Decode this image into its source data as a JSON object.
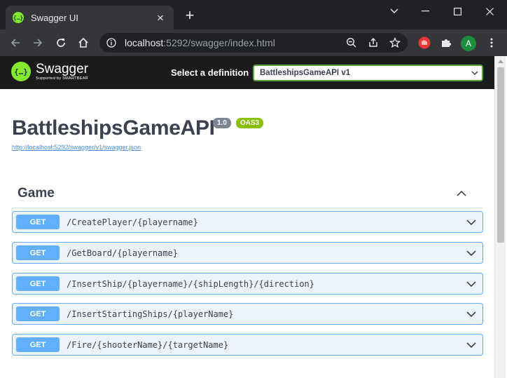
{
  "browser": {
    "tab_title": "Swagger UI",
    "favicon_glyph": "{…}",
    "new_tab_symbol": "+",
    "close_symbol": "×",
    "url_host": "localhost",
    "url_rest": ":5292/swagger/index.html",
    "profile_initial": "A",
    "colors": {
      "frame": "#202124",
      "toolbar": "#35363a",
      "avatar": "#1e8e3e",
      "extension_red": "#e53935"
    }
  },
  "swagger": {
    "topbar": {
      "logo_glyph": "{…}",
      "logo_name": "Swagger",
      "logo_sub": "Supported by SMARTBEAR",
      "definition_label": "Select a definition",
      "definition_selected": "BattleshipsGameAPI v1"
    },
    "info": {
      "title": "BattleshipsGameAPI",
      "version_badge": "1.0",
      "oas_badge": "OAS3",
      "spec_link": "http://localhost:5292/swagger/v1/swagger.json"
    },
    "tag": {
      "name": "Game",
      "expanded": true
    },
    "operations": [
      {
        "method": "GET",
        "path": "/CreatePlayer/{playername}"
      },
      {
        "method": "GET",
        "path": "/GetBoard/{playername}"
      },
      {
        "method": "GET",
        "path": "/InsertShip/{playername}/{shipLength}/{direction}"
      },
      {
        "method": "GET",
        "path": "/InsertStartingShips/{playerName}"
      },
      {
        "method": "GET",
        "path": "/Fire/{shooterName}/{targetName}"
      }
    ],
    "colors": {
      "topbar": "#1b1b1b",
      "brand_green": "#85ea2d",
      "get_blue": "#61affe",
      "get_bg": "#ebf3fb",
      "text": "#3b4151",
      "link": "#4990e2"
    }
  }
}
